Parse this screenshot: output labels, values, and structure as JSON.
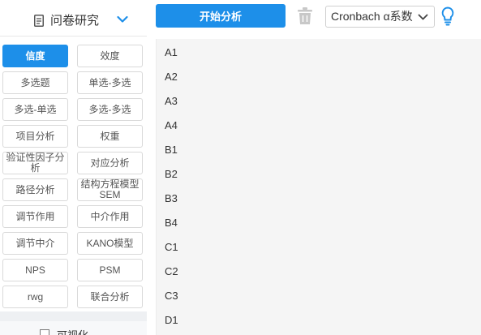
{
  "sidebar": {
    "header_title": "问卷研究",
    "buttons": [
      {
        "label": "信度",
        "active": true
      },
      {
        "label": "效度"
      },
      {
        "label": "多选题"
      },
      {
        "label": "单选-多选"
      },
      {
        "label": "多选-单选"
      },
      {
        "label": "多选-多选"
      },
      {
        "label": "项目分析"
      },
      {
        "label": "权重"
      },
      {
        "label": "验证性因子分析"
      },
      {
        "label": "对应分析"
      },
      {
        "label": "路径分析"
      },
      {
        "label": "结构方程模型SEM"
      },
      {
        "label": "调节作用"
      },
      {
        "label": "中介作用"
      },
      {
        "label": "调节中介"
      },
      {
        "label": "KANO模型"
      },
      {
        "label": "NPS"
      },
      {
        "label": "PSM"
      },
      {
        "label": "rwg"
      },
      {
        "label": "联合分析"
      }
    ],
    "footer_label": "可视化"
  },
  "toolbar": {
    "start_label": "开始分析",
    "method_selected": "Cronbach α系数"
  },
  "variables": [
    "A1",
    "A2",
    "A3",
    "A4",
    "B1",
    "B2",
    "B3",
    "B4",
    "C1",
    "C2",
    "C3",
    "D1"
  ],
  "colors": {
    "accent": "#1d8fe9",
    "border": "#d9d9d9",
    "panel_bg": "#f5f5f5",
    "disabled_icon": "#c8c8c8"
  },
  "icons": {
    "header": "document-icon",
    "header_toggle": "chevron-down-icon",
    "delete": "trash-icon",
    "select_toggle": "chevron-down-icon",
    "tip": "lightbulb-icon"
  }
}
